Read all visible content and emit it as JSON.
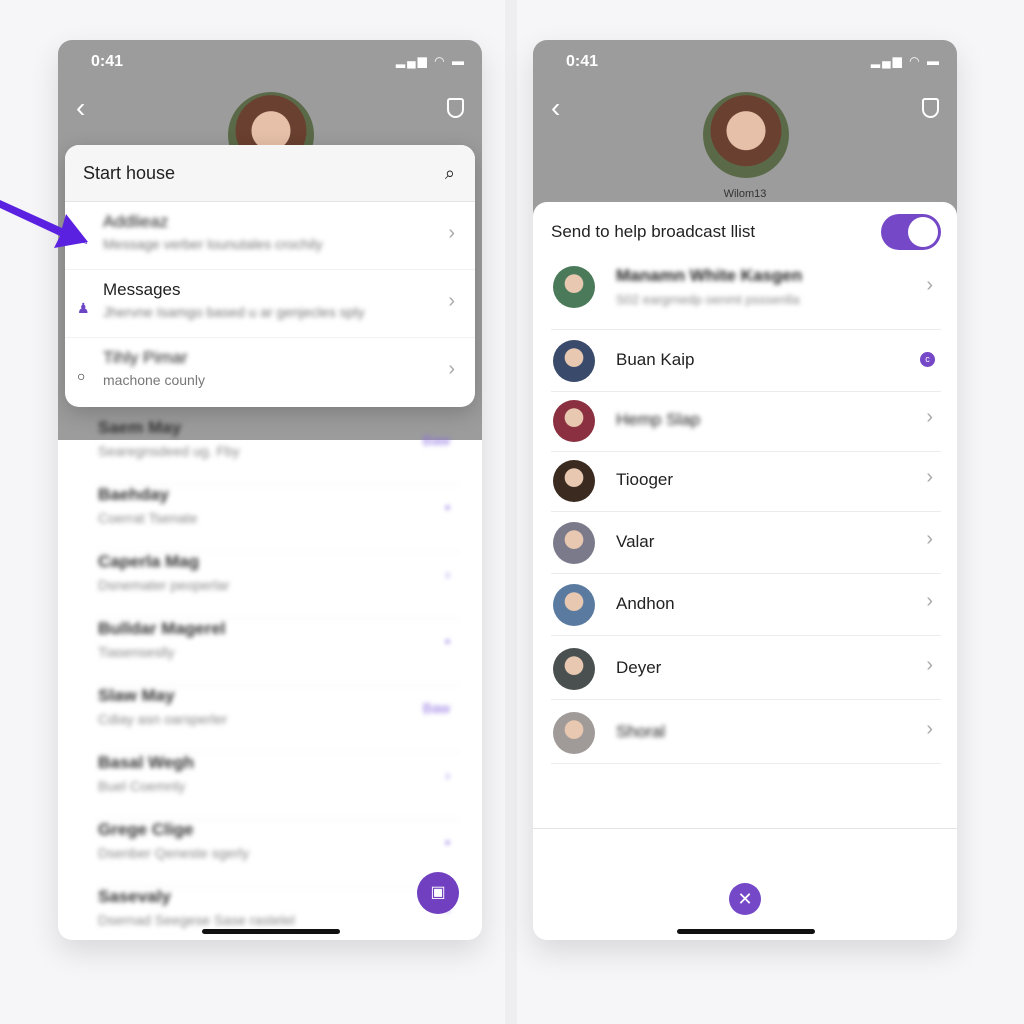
{
  "colors": {
    "accent": "#7548c8",
    "header": "#9c9c9c"
  },
  "left": {
    "status": {
      "time": "0:41"
    },
    "popup": {
      "title": "Start house",
      "items": [
        {
          "title": "Addlieaz",
          "subtitle": "Message verber lounutales crochily",
          "icon": "edit-icon"
        },
        {
          "title": "Messages",
          "subtitle": "Jhervne Isamgo based u ar genjecles sply",
          "icon": "person-icon"
        },
        {
          "title": "Tihly Pimar",
          "subtitle": "machone counly",
          "icon": "circle-icon"
        }
      ]
    },
    "list": [
      {
        "title": "Saem May",
        "subtitle": "Searegnsdeed ug. Fby",
        "tag": "Baw"
      },
      {
        "title": "Baehday",
        "subtitle": "Coerrat Tsenate",
        "tag": "•"
      },
      {
        "title": "Caperla Mag",
        "subtitle": "Dsnemater peoperlar",
        "tag": "›"
      },
      {
        "title": "Bulldar Magerel",
        "subtitle": "Tiasenseslly",
        "tag": "•"
      },
      {
        "title": "Slaw May",
        "subtitle": "Cdiay asn oarsperler",
        "tag": "Baw"
      },
      {
        "title": "Basal Wegh",
        "subtitle": "Buel Coemnly",
        "tag": "›"
      },
      {
        "title": "Grege Clige",
        "subtitle": "Dsenber Qeneste sgerly",
        "tag": "•"
      },
      {
        "title": "Sasevaly",
        "subtitle": "Dsernad Seegese Sase rastelel",
        "tag": "›"
      }
    ]
  },
  "right": {
    "status": {
      "time": "0:41"
    },
    "username": "Wilom13",
    "broadcast_label": "Send to help broadcast llist",
    "broadcast_on": true,
    "contacts": [
      {
        "name": "Manamn White Kasgen",
        "blurred": true,
        "subtitle": "S02 eargrnedp oenmt psssenlla"
      },
      {
        "name": "Buan Kaip",
        "badge": "c"
      },
      {
        "name": "Hemp Slap",
        "blurred": true
      },
      {
        "name": "Tiooger"
      },
      {
        "name": "Valar"
      },
      {
        "name": "Andhon"
      },
      {
        "name": "Deyer"
      },
      {
        "name": "Shoral",
        "blurred": true
      }
    ]
  }
}
